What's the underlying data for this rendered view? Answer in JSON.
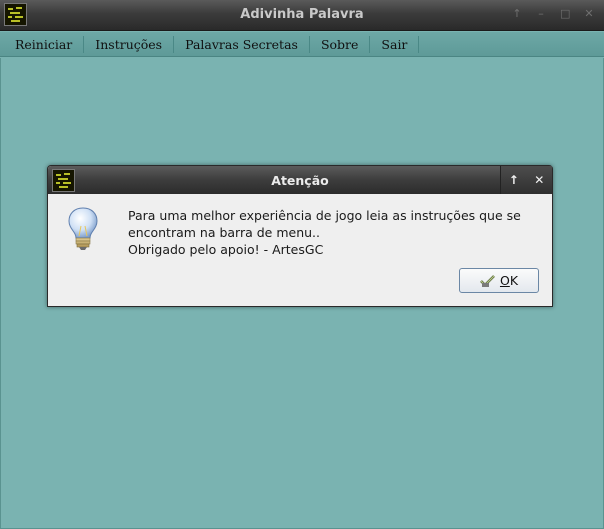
{
  "window": {
    "title": "Adivinha Palavra",
    "wm_buttons": [
      "↑",
      "–",
      "□",
      "✕"
    ]
  },
  "menu": {
    "items": [
      "Reiniciar",
      "Instruções",
      "Palavras Secretas",
      "Sobre",
      "Sair"
    ]
  },
  "dialog": {
    "title": "Atenção",
    "wm_buttons": [
      "↑",
      "✕"
    ],
    "icon": "lightbulb-icon",
    "message_lines": [
      "Para uma melhor experiência de jogo leia as instruções que se",
      "encontram na barra de menu..",
      "Obrigado pelo apoio! - ArtesGC"
    ],
    "ok_mnemonic": "O",
    "ok_rest": "K"
  },
  "colors": {
    "background": "#7ab3b1",
    "menubar": "#6da8a6",
    "dialog": "#efefef",
    "titlebar": "#3b3b3b"
  }
}
